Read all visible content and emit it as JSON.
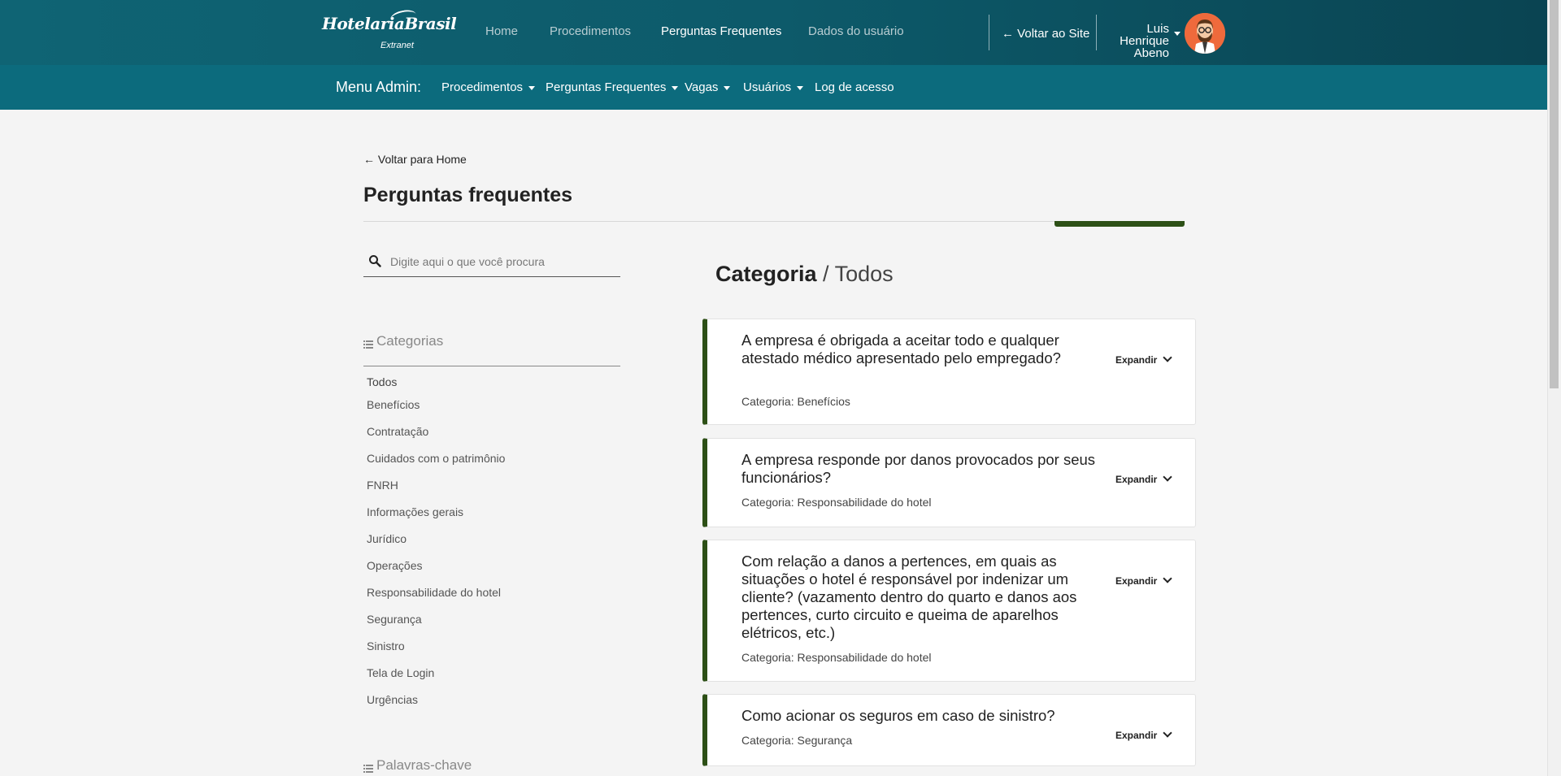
{
  "header": {
    "logo_brand": "HotelariaBrasil",
    "logo_sub": "Extranet",
    "nav": [
      "Home",
      "Procedimentos",
      "Perguntas Frequentes",
      "Dados do usuário"
    ],
    "active_nav": "Perguntas Frequentes",
    "back_to_site": "Voltar ao Site",
    "user_name_lines": [
      "Luis",
      "Henrique",
      "Abeno"
    ]
  },
  "admin_menu": {
    "label": "Menu Admin:",
    "items": [
      "Procedimentos",
      "Perguntas Frequentes",
      "Vagas",
      "Usuários",
      "Log de acesso"
    ]
  },
  "page": {
    "back_home": "Voltar para Home",
    "title": "Perguntas frequentes"
  },
  "search": {
    "placeholder": "Digite aqui o que você procura"
  },
  "sidebar": {
    "categories_title": "Categorias",
    "categories": [
      "Todos",
      "Benefícios",
      "Contratação",
      "Cuidados com o patrimônio",
      "FNRH",
      "Informações gerais",
      "Jurídico",
      "Operações",
      "Responsabilidade do hotel",
      "Segurança",
      "Sinistro",
      "Tela de Login",
      "Urgências"
    ],
    "keywords_title": "Palavras-chave"
  },
  "main": {
    "heading_bold": "Categoria",
    "heading_sep": " / ",
    "heading_value": "Todos",
    "expand_label": "Expandir",
    "faqs": [
      {
        "question": "A empresa é obrigada a aceitar todo e qualquer atestado médico apresentado pelo empregado?",
        "category": "Categoria: Benefícios"
      },
      {
        "question": "A empresa responde por danos provocados por seus funcionários?",
        "category": "Categoria: Responsabilidade do hotel"
      },
      {
        "question": "Com relação a danos a pertences, em quais as situações o hotel é responsável por indenizar um cliente? (vazamento dentro do quarto e danos aos pertences, curto circuito e queima de aparelhos elétricos, etc.)",
        "category": "Categoria: Responsabilidade do hotel"
      },
      {
        "question": "Como acionar os seguros em caso de sinistro?",
        "category": "Categoria: Segurança"
      }
    ]
  },
  "colors": {
    "topbar": "#0f6474",
    "adminbar": "#0c6b7d",
    "accent": "#2d5016",
    "avatar": "#ef6a3c"
  }
}
